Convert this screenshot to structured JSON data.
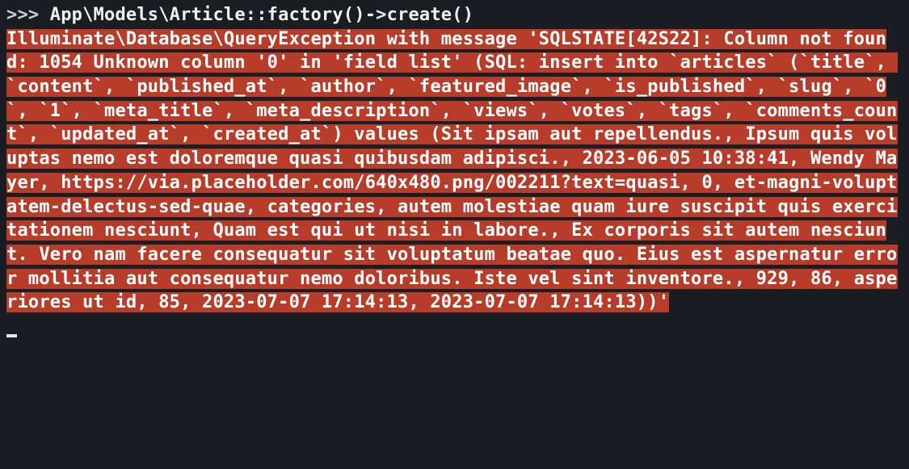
{
  "terminal": {
    "prompt": ">>> ",
    "command": "App\\Models\\Article::factory()->create()",
    "error_text": "Illuminate\\Database\\QueryException with message 'SQLSTATE[42S22]: Column not found: 1054 Unknown column '0' in 'field list' (SQL: insert into `articles` (`title`, `content`, `published_at`, `author`, `featured_image`, `is_published`, `slug`, `0`, `1`, `meta_title`, `meta_description`, `views`, `votes`, `tags`, `comments_count`, `updated_at`, `created_at`) values (Sit ipsam aut repellendus., Ipsum quis voluptas nemo est doloremque quasi quibusdam adipisci., 2023-06-05 10:38:41, Wendy Mayer, https://via.placeholder.com/640x480.png/002211?text=quasi, 0, et-magni-voluptatem-delectus-sed-quae, categories, autem molestiae quam iure suscipit quis exercitationem nesciunt, Quam est qui ut nisi in labore., Ex corporis sit autem nesciunt. Vero nam facere consequatur sit voluptatum beatae quo. Eius est aspernatur error mollitia aut consequatur nemo doloribus. Iste vel sint inventore., 929, 86, asperiores ut id, 85, 2023-07-07 17:14:13, 2023-07-07 17:14:13))'"
  }
}
